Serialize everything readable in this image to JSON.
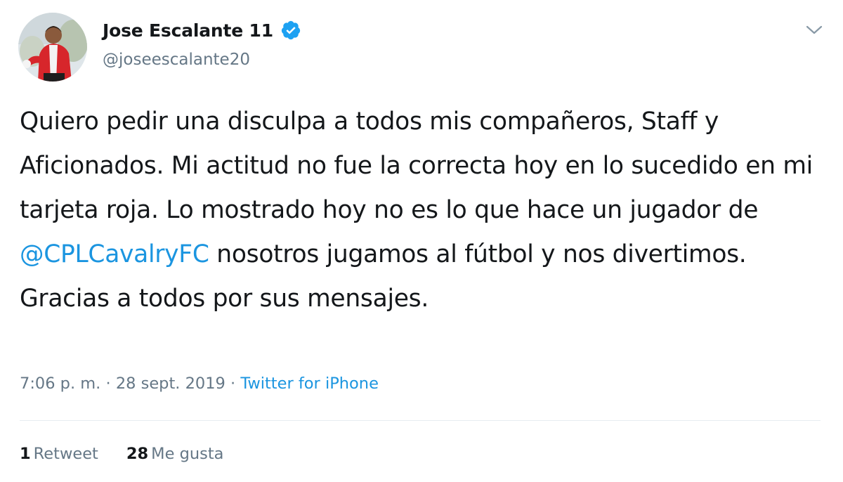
{
  "author": {
    "display_name": "Jose Escalante 11",
    "handle": "@joseescalante20",
    "verified": true,
    "avatar_icon": "player-avatar-image"
  },
  "tweet": {
    "segments": [
      {
        "text": "Quiero pedir una disculpa a todos mis compañeros, Staff y Aficionados. Mi actitud no fue la correcta hoy en lo sucedido en mi tarjeta roja. Lo mostrado hoy no es lo que hace un jugador de ",
        "type": "text"
      },
      {
        "text": "@CPLCavalryFC",
        "type": "mention"
      },
      {
        "text": " nosotros jugamos al fútbol y nos divertimos. Gracias a todos por sus mensajes.",
        "type": "text"
      }
    ]
  },
  "meta": {
    "time": "7:06 p. m.",
    "sep1": " · ",
    "date": "28 sept. 2019",
    "sep2": " · ",
    "source": "Twitter for iPhone"
  },
  "stats": {
    "retweets_count": "1",
    "retweets_label": "Retweet",
    "likes_count": "28",
    "likes_label": "Me gusta"
  },
  "colors": {
    "link": "#1b95e0",
    "muted": "#657786",
    "text": "#14171a",
    "verified": "#1da1f2"
  }
}
